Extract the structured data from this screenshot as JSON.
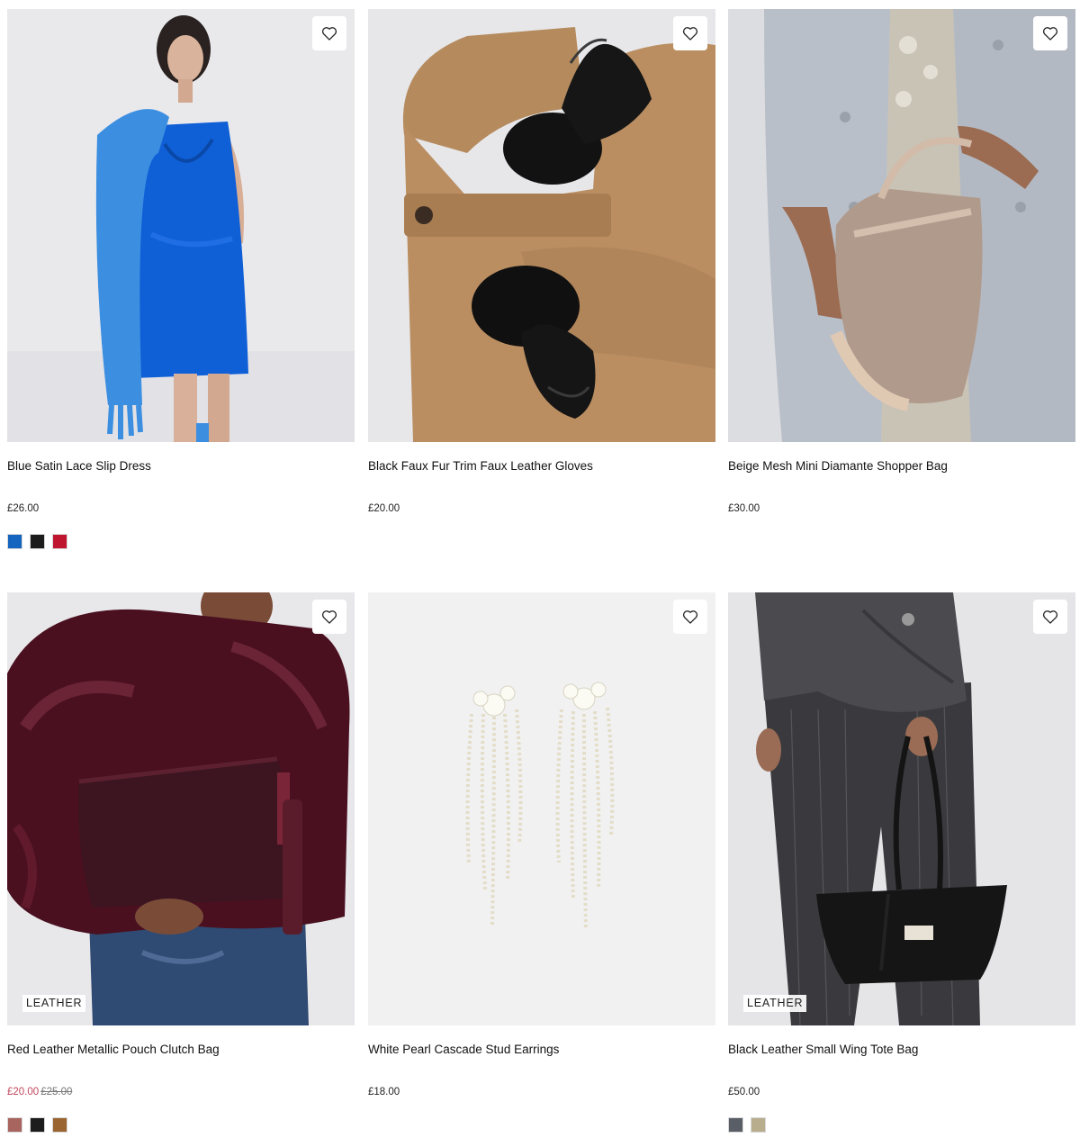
{
  "products": [
    {
      "name": "Blue Satin Lace Slip Dress",
      "price": "£26.00",
      "tag": "",
      "swatches": [
        "#1565c0",
        "#1c1c1c",
        "#c0152f"
      ]
    },
    {
      "name": "Black Faux Fur Trim Faux Leather Gloves",
      "price": "£20.00",
      "tag": "",
      "swatches": []
    },
    {
      "name": "Beige Mesh Mini Diamante Shopper Bag",
      "price": "£30.00",
      "tag": "",
      "swatches": []
    },
    {
      "name": "Red Leather Metallic Pouch Clutch Bag",
      "sale_price": "£20.00",
      "was_price": "£25.00",
      "tag": "LEATHER",
      "swatches": [
        "#a86560",
        "#1c1c1c",
        "#9a6530"
      ]
    },
    {
      "name": "White Pearl Cascade Stud Earrings",
      "price": "£18.00",
      "tag": "",
      "swatches": []
    },
    {
      "name": "Black Leather Small Wing Tote Bag",
      "price": "£50.00",
      "tag": "LEATHER",
      "swatches": [
        "#5a5e66",
        "#b8ae8e"
      ]
    }
  ],
  "icons": {
    "wishlist": "heart-outline-icon"
  },
  "colors": {
    "sale": "#c2455b",
    "text": "#111111",
    "image_bg": "#ececec"
  }
}
